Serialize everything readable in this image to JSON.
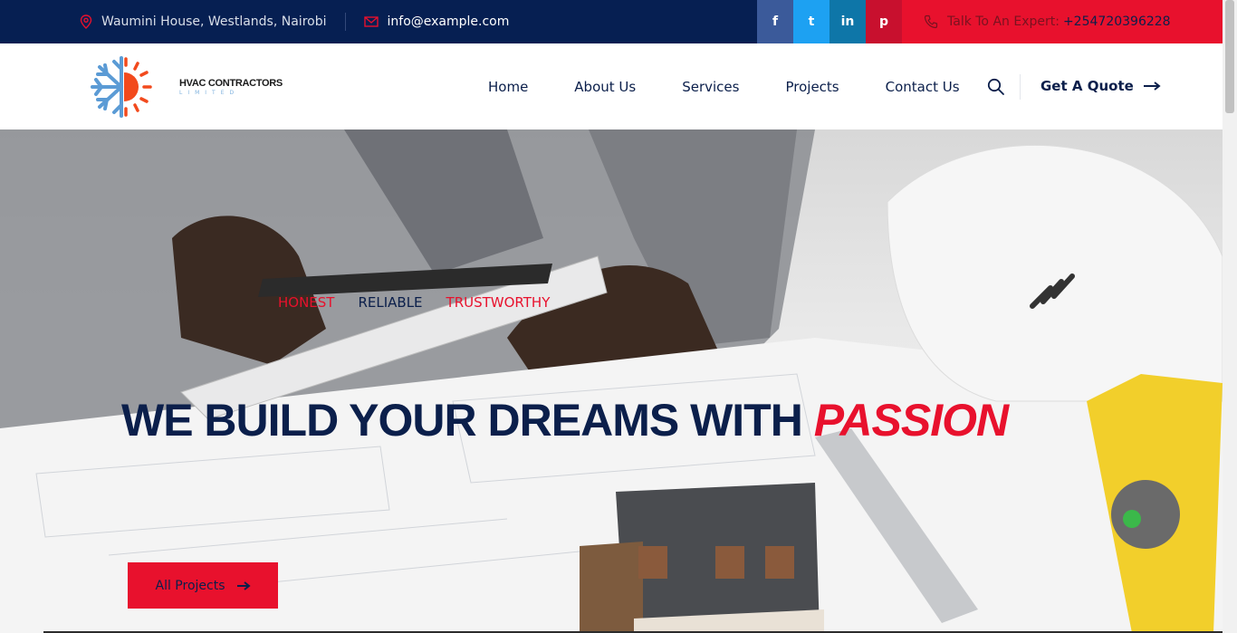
{
  "topbar": {
    "address": "Waumini House, Westlands, Nairobi",
    "email": "info@example.com",
    "socials": [
      {
        "icon": "facebook-icon",
        "glyph": "f"
      },
      {
        "icon": "twitter-icon",
        "glyph": "t"
      },
      {
        "icon": "linkedin-icon",
        "glyph": "in"
      },
      {
        "icon": "pinterest-icon",
        "glyph": "p"
      }
    ],
    "expert_label": "Talk To An Expert:",
    "expert_phone": "+254720396228"
  },
  "logo": {
    "name": "HVAC CONTRACTORS",
    "sub": "LIMITED"
  },
  "nav": {
    "items": [
      "Home",
      "About Us",
      "Services",
      "Projects",
      "Contact Us"
    ],
    "quote_label": "Get A Quote"
  },
  "hero": {
    "tags": [
      "HONEST",
      "RELIABLE",
      "TRUSTWORTHY"
    ],
    "headline": "WE BUILD YOUR DREAMS WITH",
    "headline_accent": "PASSION",
    "button_label": "All Projects"
  },
  "colors": {
    "navy": "#061f52",
    "red": "#e8112d",
    "text": "#0b1f4b"
  }
}
